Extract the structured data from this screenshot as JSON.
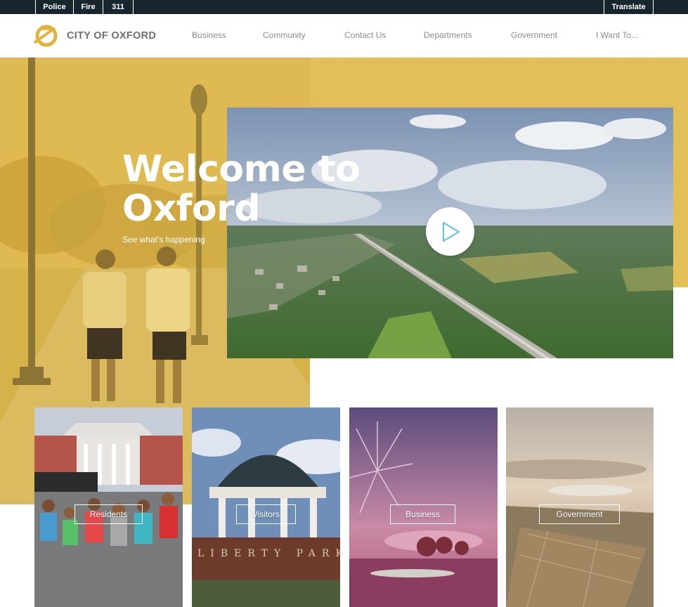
{
  "utility": {
    "police": "Police",
    "fire": "Fire",
    "three11": "311",
    "translate": "Translate"
  },
  "header": {
    "logo_text": "CITY OF OXFORD",
    "nav": {
      "business": "Business",
      "community": "Community",
      "contact": "Contact Us",
      "departments": "Departments",
      "government": "Government",
      "i_want_to": "I Want To..."
    }
  },
  "hero": {
    "title": "Welcome to Oxford",
    "subtitle": "See what's happening"
  },
  "cards": {
    "residents": "Residents",
    "visitors": "Visitors",
    "business": "Business",
    "government": "Government"
  },
  "colors": {
    "brand_gold": "#e3bf57",
    "utility_bar": "#17262c",
    "nav_text": "#8a8c8f",
    "play_icon": "#5fc3d3"
  },
  "icons": {
    "logo": "oxford-logo-icon",
    "play": "play-icon"
  },
  "aerial_detail": {
    "sign_text": "LIBERTY PARK"
  }
}
